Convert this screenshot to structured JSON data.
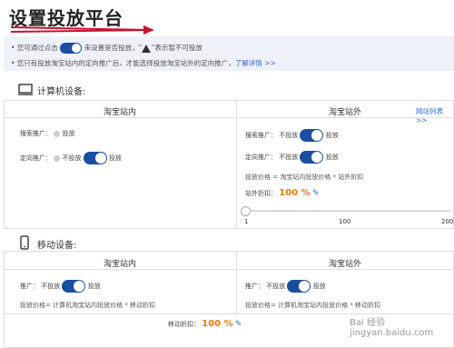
{
  "page": {
    "title": "设置投放平台"
  },
  "info": {
    "line1_a": "您可通过点击",
    "line1_b": "来设置是否投放，“",
    "line1_c": "”表示暂不可投放",
    "line2": "您只有投放淘宝站内的定向推广后，才能选择投放淘宝站外的定向推广，",
    "line2_link": "了解详情 >>"
  },
  "computer": {
    "heading": "计算机设备:",
    "inside": {
      "title": "淘宝站内",
      "search_label": "搜索推广：",
      "search_value": "投放",
      "targeted_label": "定向推广：",
      "targeted_off": "不投放",
      "targeted_on": "投放"
    },
    "outside": {
      "title": "淘宝站外",
      "site_list_link": "网站列表 >>",
      "search_label": "搜索推广：",
      "search_off": "不投放",
      "search_on": "投放",
      "targeted_label": "定向推广：",
      "targeted_off": "不投放",
      "targeted_on": "投放",
      "price_formula": "投放价格 = 淘宝站内投放价格 * 站外折扣",
      "discount_label": "站外折扣：",
      "discount_value": "100 %",
      "slider_ticks": [
        "1",
        "100",
        "200"
      ],
      "slider_value_percent": 0
    }
  },
  "mobile": {
    "heading": "移动设备:",
    "inside": {
      "title": "淘宝站内",
      "promo_label": "推广：",
      "promo_off": "不投放",
      "promo_on": "投放",
      "price_formula": "投放价格= 计算机淘宝站内投放价格 * 移动折扣",
      "discount_label": "移动折扣：",
      "discount_value": "100 %"
    },
    "outside": {
      "title": "淘宝站外",
      "promo_label": "推广：",
      "promo_off": "不投放",
      "promo_on": "投放",
      "price_formula": "投放价格= 计算机淘宝站内投放价格 * 移动折扣"
    }
  },
  "watermark": "Bai 经验 jingyan.baidu.com",
  "colors": {
    "accent": "#1a4fa0",
    "link": "#2a6bd1",
    "orange": "#e77b0b",
    "arrow": "#c8102e"
  }
}
